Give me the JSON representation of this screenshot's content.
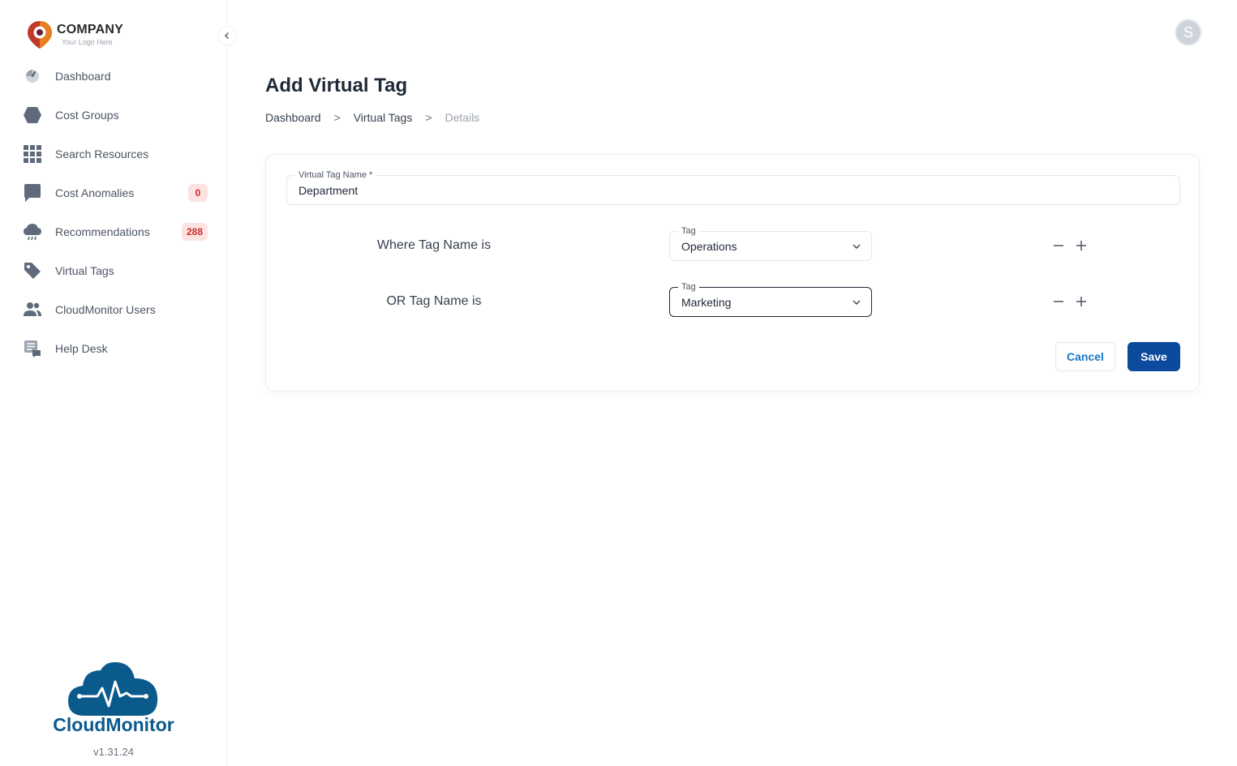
{
  "company": {
    "name": "COMPANY",
    "tagline": "Your Logo Here"
  },
  "sidebar": {
    "items": [
      {
        "label": "Dashboard",
        "icon": "gauge-icon"
      },
      {
        "label": "Cost Groups",
        "icon": "hexagon-icon"
      },
      {
        "label": "Search Resources",
        "icon": "grid-icon"
      },
      {
        "label": "Cost Anomalies",
        "icon": "chat-icon",
        "badge": "0"
      },
      {
        "label": "Recommendations",
        "icon": "cloud-icon",
        "badge": "288"
      },
      {
        "label": "Virtual Tags",
        "icon": "tag-icon"
      },
      {
        "label": "CloudMonitor Users",
        "icon": "users-icon"
      },
      {
        "label": "Help Desk",
        "icon": "helpdesk-icon"
      }
    ],
    "collapse_icon": "chevron-left-icon"
  },
  "brand": {
    "name": "CloudMonitor",
    "version": "v1.31.24"
  },
  "user": {
    "avatar_initial": "S"
  },
  "page": {
    "title": "Add Virtual Tag",
    "breadcrumb": [
      "Dashboard",
      "Virtual Tags",
      "Details"
    ],
    "breadcrumb_separator": ">"
  },
  "form": {
    "name_field": {
      "label": "Virtual Tag Name *",
      "value": "Department"
    },
    "conditions": [
      {
        "label": "Where Tag Name is",
        "select_label": "Tag",
        "value": "Operations"
      },
      {
        "label": "OR Tag Name is",
        "select_label": "Tag",
        "value": "Marketing"
      }
    ],
    "cancel_label": "Cancel",
    "save_label": "Save"
  },
  "colors": {
    "primary": "#0b4a9c",
    "link": "#1677c9",
    "badge_bg": "#fde2e2",
    "badge_text": "#c53030",
    "brand": "#0b5a8c",
    "icon": "#5f6b7a"
  }
}
